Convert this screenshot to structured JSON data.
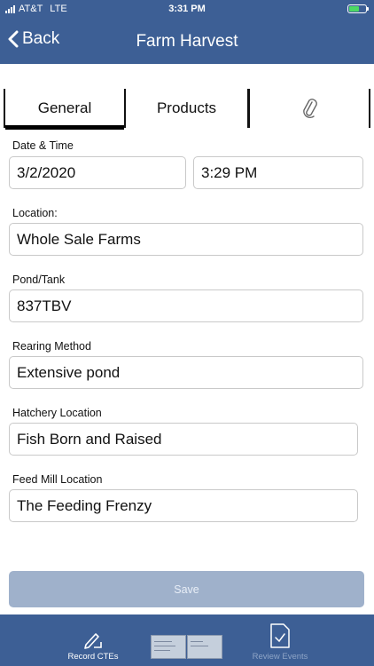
{
  "status_bar": {
    "carrier": "AT&T",
    "network": "LTE",
    "time": "3:31 PM"
  },
  "nav": {
    "back_label": "Back",
    "title": "Farm Harvest"
  },
  "tabs": [
    {
      "label": "General",
      "selected": true
    },
    {
      "label": "Products",
      "selected": false
    },
    {
      "label": "",
      "icon": "paperclip-icon",
      "selected": false
    }
  ],
  "form": {
    "date_time": {
      "label": "Date & Time",
      "date": "3/2/2020",
      "time": "3:29 PM"
    },
    "location": {
      "label": "Location:",
      "value": "Whole Sale Farms"
    },
    "pond_tank": {
      "label": "Pond/Tank",
      "value": "837TBV"
    },
    "rearing_method": {
      "label": "Rearing Method",
      "value": "Extensive pond"
    },
    "hatchery_location": {
      "label": "Hatchery Location",
      "value": "Fish Born and Raised"
    },
    "feed_mill_location": {
      "label": "Feed Mill Location",
      "value": "The Feeding Frenzy"
    }
  },
  "save_label": "Save",
  "bottom_tabs": {
    "record": {
      "label": "Record CTEs",
      "icon": "pen-icon"
    },
    "review": {
      "label": "Review Events",
      "icon": "document-check-icon"
    }
  },
  "colors": {
    "header": "#3d5f95",
    "save_button": "#9fb1cb",
    "bottom_bar": "#3d5f95"
  }
}
